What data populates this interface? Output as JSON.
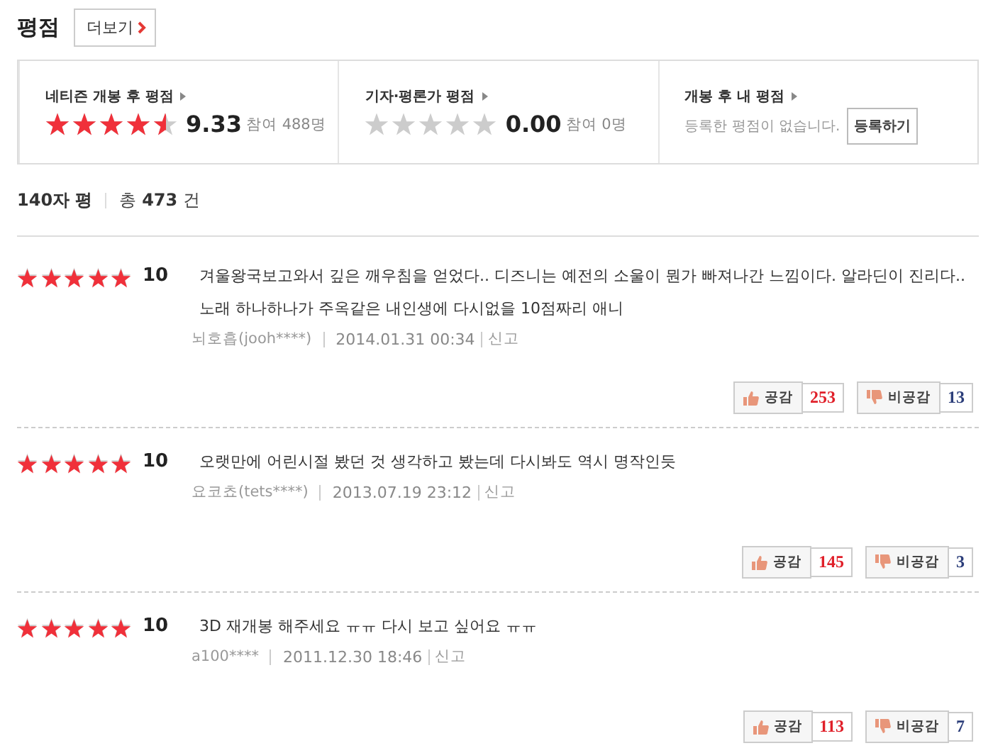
{
  "header": {
    "title": "평점",
    "more_button": "더보기"
  },
  "summary": [
    {
      "kind": "score",
      "label": "네티즌 개봉 후 평점",
      "stars": 4.5,
      "score": "9.33",
      "participants": "참여 488명"
    },
    {
      "kind": "score",
      "label": "기자·평론가 평점",
      "stars": 0,
      "score": "0.00",
      "participants": "참여 0명"
    },
    {
      "kind": "mine",
      "label": "개봉 후 내 평점",
      "message": "등록한 평점이 없습니다.",
      "button": "등록하기"
    }
  ],
  "list_header": {
    "title": "140자 평",
    "total_prefix": "총",
    "total_count": "473",
    "total_suffix": "건"
  },
  "reviews": [
    {
      "stars": 5,
      "score": "10",
      "text": "겨울왕국보고와서 깊은 깨우침을 얻었다.. 디즈니는 예전의 소울이 뭔가 빠져나간 느낌이다. 알라딘이 진리다.. 노래 하나하나가 주옥같은 내인생에 다시없을 10점짜리 애니",
      "author": "뇌호흡(jooh****)",
      "date": "2014.01.31 00:34",
      "report": "신고",
      "like_label": "공감",
      "likes": "253",
      "dislike_label": "비공감",
      "dislikes": "13"
    },
    {
      "stars": 5,
      "score": "10",
      "text": "오랫만에 어린시절 봤던 것 생각하고 봤는데 다시봐도 역시 명작인듯",
      "author": "요코쵸(tets****)",
      "date": "2013.07.19 23:12",
      "report": "신고",
      "like_label": "공감",
      "likes": "145",
      "dislike_label": "비공감",
      "dislikes": "3"
    },
    {
      "stars": 5,
      "score": "10",
      "text": "3D 재개봉 해주세요 ㅠㅠ 다시 보고 싶어요 ㅠㅠ",
      "author": "a100****",
      "date": "2011.12.30 18:46",
      "report": "신고",
      "like_label": "공감",
      "likes": "113",
      "dislike_label": "비공감",
      "dislikes": "7"
    }
  ]
}
